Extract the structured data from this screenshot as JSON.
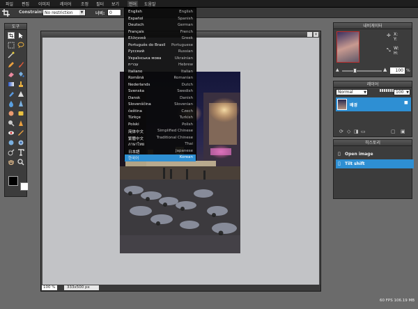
{
  "menu": [
    "파일",
    "편집",
    "이미지",
    "레이어",
    "조정",
    "필터",
    "보기",
    "언어",
    "도움말"
  ],
  "options": {
    "constraint_label": "Constraint:",
    "constraint_value": "No restriction",
    "width_label": "너비:",
    "width_value": "0"
  },
  "language_menu": {
    "items": [
      {
        "native": "English",
        "english": "English"
      },
      {
        "native": "Español",
        "english": "Spanish"
      },
      {
        "native": "Deutsch",
        "english": "German"
      },
      {
        "native": "Français",
        "english": "French"
      },
      {
        "native": "Ελληνικά",
        "english": "Greek"
      },
      {
        "native": "Português do Brasil",
        "english": "Portuguese"
      },
      {
        "native": "Русский",
        "english": "Russian"
      },
      {
        "native": "Українська мова",
        "english": "Ukrainian"
      },
      {
        "native": "עברית",
        "english": "Hebrew"
      },
      {
        "native": "Italiano",
        "english": "Italian"
      },
      {
        "native": "Română",
        "english": "Romanian"
      },
      {
        "native": "Nederlands",
        "english": "Dutch"
      },
      {
        "native": "Svenska",
        "english": "Swedish"
      },
      {
        "native": "Dansk",
        "english": "Danish"
      },
      {
        "native": "Slovenščina",
        "english": "Slovenian"
      },
      {
        "native": "čeština",
        "english": "Czech"
      },
      {
        "native": "Türkçe",
        "english": "Turkish"
      },
      {
        "native": "Polski",
        "english": "Polish"
      },
      {
        "native": "简体中文",
        "english": "Simplified Chinese"
      },
      {
        "native": "繁體中文",
        "english": "Traditional Chinese"
      },
      {
        "native": "ภาษาไทย",
        "english": "Thai"
      },
      {
        "native": "日本語",
        "english": "Japanese"
      },
      {
        "native": "한국어",
        "english": "Korean"
      }
    ],
    "selected": "한국어"
  },
  "tools_panel": {
    "title": "도구"
  },
  "navigator": {
    "title": "내비게이터",
    "x_label": "X:",
    "y_label": "Y:",
    "w_label": "W:",
    "h_label": "H:",
    "zoom_value": "100",
    "zoom_unit": "%"
  },
  "layers": {
    "title": "레이어",
    "blend_mode": "Normal",
    "opacity": "100",
    "layer_name": "배경"
  },
  "history": {
    "title": "히스토리",
    "items": [
      "Open image",
      "Tilt shift"
    ],
    "selected": "Tilt shift"
  },
  "canvas": {
    "zoom": "100",
    "zoom_unit": "%",
    "size": "333x500 px"
  },
  "status": {
    "fps": "60 FPS 106.19 MB"
  },
  "colors": {
    "menu_bg": "#1e1e1e",
    "accent": "#2e8fd3",
    "canvas_bg": "#c2c3c6",
    "panel_bg": "#3c3c3c",
    "foreground": "#000000",
    "background": "#ffffff"
  }
}
